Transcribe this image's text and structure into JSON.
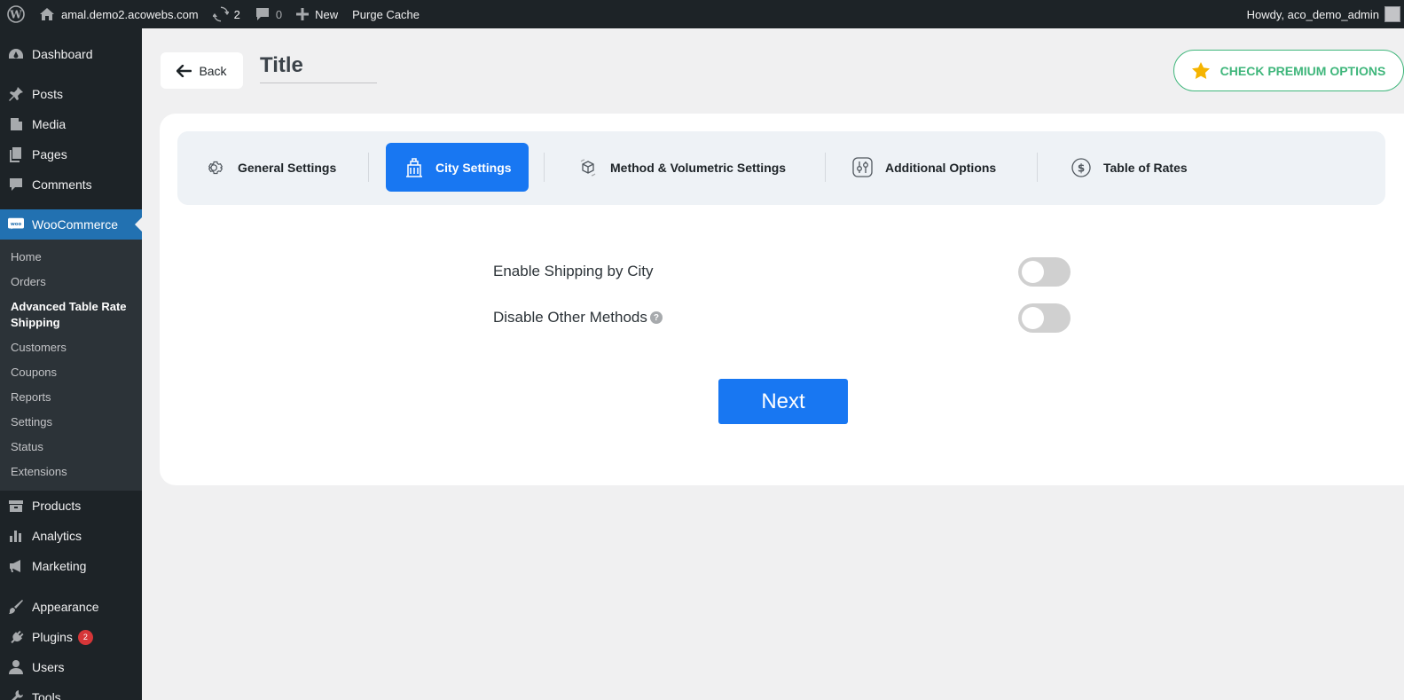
{
  "adminbar": {
    "wp_logo_icon": "wordpress-icon",
    "site_name": "amal.demo2.acowebs.com",
    "updates_count": "2",
    "comments_count": "0",
    "new_label": "New",
    "purge_cache": "Purge Cache",
    "howdy": "Howdy, aco_demo_admin"
  },
  "sidebar": {
    "items_top": [
      {
        "label": "Dashboard",
        "icon": "dashboard-icon"
      },
      {
        "label": "Posts",
        "icon": "pin-icon"
      },
      {
        "label": "Media",
        "icon": "media-icon"
      },
      {
        "label": "Pages",
        "icon": "pages-icon"
      },
      {
        "label": "Comments",
        "icon": "comment-icon"
      }
    ],
    "woocommerce": "WooCommerce",
    "submenu": [
      "Home",
      "Orders",
      "Advanced Table Rate Shipping",
      "Customers",
      "Coupons",
      "Reports",
      "Settings",
      "Status",
      "Extensions"
    ],
    "items_bottom": [
      {
        "label": "Products",
        "icon": "archive-icon"
      },
      {
        "label": "Analytics",
        "icon": "chart-bar-icon"
      },
      {
        "label": "Marketing",
        "icon": "megaphone-icon"
      },
      {
        "label": "Appearance",
        "icon": "brush-icon"
      },
      {
        "label": "Plugins",
        "icon": "plugin-icon",
        "badge": "2"
      },
      {
        "label": "Users",
        "icon": "users-icon"
      },
      {
        "label": "Tools",
        "icon": "tools-icon"
      }
    ]
  },
  "header": {
    "back_label": "Back",
    "title": "Title",
    "premium_label": "CHECK PREMIUM OPTIONS"
  },
  "tabs": [
    {
      "label": "General Settings",
      "icon": "gear-icon"
    },
    {
      "label": "City Settings",
      "icon": "building-icon",
      "active": true
    },
    {
      "label": "Method & Volumetric Settings",
      "icon": "box-icon"
    },
    {
      "label": "Additional Options",
      "icon": "sliders-icon"
    },
    {
      "label": "Table of Rates",
      "icon": "dollar-icon"
    }
  ],
  "form": {
    "enable_shipping_label": "Enable Shipping by City",
    "enable_shipping_on": false,
    "disable_other_label": "Disable Other Methods",
    "disable_other_on": false,
    "help_glyph": "?",
    "next_label": "Next"
  },
  "colors": {
    "accent": "#1877f2",
    "premium": "#3fb67b",
    "wp_blue": "#2271b1"
  }
}
